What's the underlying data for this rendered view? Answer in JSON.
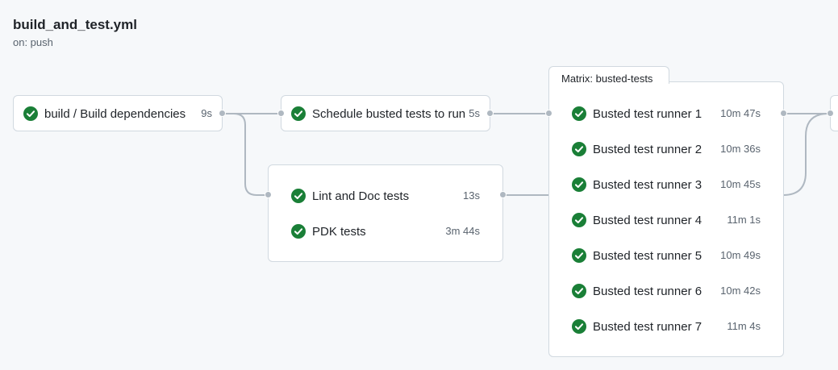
{
  "workflow": {
    "title": "build_and_test.yml",
    "trigger": "on: push"
  },
  "colors": {
    "success": "#1a7f37",
    "connector": "#afb8c1",
    "border": "#d1d9e0",
    "background": "#f6f8fa"
  },
  "icons": {
    "job_status": "check-circle-icon"
  },
  "jobs": {
    "build": {
      "name": "build / Build dependencies",
      "duration": "9s"
    },
    "schedule": {
      "name": "Schedule busted tests to run",
      "duration": "5s"
    },
    "lint_group": [
      {
        "name": "Lint and Doc tests",
        "duration": "13s"
      },
      {
        "name": "PDK tests",
        "duration": "3m 44s"
      }
    ],
    "matrix": {
      "label": "Matrix: busted-tests",
      "runners": [
        {
          "name": "Busted test runner 1",
          "duration": "10m 47s"
        },
        {
          "name": "Busted test runner 2",
          "duration": "10m 36s"
        },
        {
          "name": "Busted test runner 3",
          "duration": "10m 45s"
        },
        {
          "name": "Busted test runner 4",
          "duration": "11m 1s"
        },
        {
          "name": "Busted test runner 5",
          "duration": "10m 49s"
        },
        {
          "name": "Busted test runner 6",
          "duration": "10m 42s"
        },
        {
          "name": "Busted test runner 7",
          "duration": "11m 4s"
        }
      ]
    }
  }
}
